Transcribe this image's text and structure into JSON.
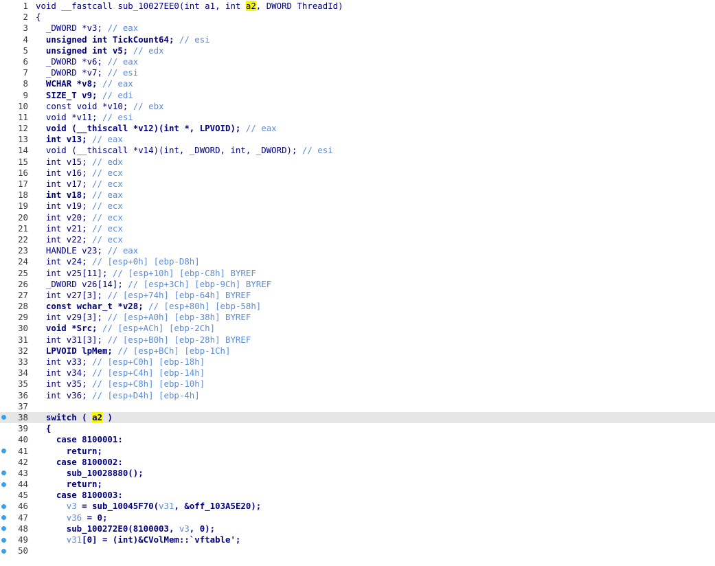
{
  "editor": {
    "lines": [
      {
        "n": "1",
        "parts": [
          [
            "p",
            "void __fastcall sub_10027EE0(int a1, int "
          ],
          [
            "h",
            "a2"
          ],
          [
            "p",
            ", DWORD ThreadId)"
          ]
        ],
        "bp": false
      },
      {
        "n": "2",
        "parts": [
          [
            "p",
            "{"
          ]
        ],
        "bp": false
      },
      {
        "n": "3",
        "parts": [
          [
            "p",
            "  _DWORD *v3; "
          ],
          [
            "c",
            "// eax"
          ]
        ],
        "bp": false
      },
      {
        "n": "4",
        "parts": [
          [
            "k",
            "  unsigned int TickCount64; "
          ],
          [
            "c",
            "// esi"
          ]
        ],
        "bp": false
      },
      {
        "n": "5",
        "parts": [
          [
            "k",
            "  unsigned int v5; "
          ],
          [
            "c",
            "// edx"
          ]
        ],
        "bp": false
      },
      {
        "n": "6",
        "parts": [
          [
            "p",
            "  _DWORD *v6; "
          ],
          [
            "c",
            "// eax"
          ]
        ],
        "bp": false
      },
      {
        "n": "7",
        "parts": [
          [
            "p",
            "  _DWORD *v7; "
          ],
          [
            "c",
            "// esi"
          ]
        ],
        "bp": false
      },
      {
        "n": "8",
        "parts": [
          [
            "k",
            "  WCHAR *v8; "
          ],
          [
            "c",
            "// eax"
          ]
        ],
        "bp": false
      },
      {
        "n": "9",
        "parts": [
          [
            "k",
            "  SIZE_T v9; "
          ],
          [
            "c",
            "// edi"
          ]
        ],
        "bp": false
      },
      {
        "n": "10",
        "parts": [
          [
            "p",
            "  const void *v10; "
          ],
          [
            "c",
            "// ebx"
          ]
        ],
        "bp": false
      },
      {
        "n": "11",
        "parts": [
          [
            "p",
            "  void *v11; "
          ],
          [
            "c",
            "// esi"
          ]
        ],
        "bp": false
      },
      {
        "n": "12",
        "parts": [
          [
            "k",
            "  void (__thiscall *v12)(int *, LPVOID); "
          ],
          [
            "c",
            "// eax"
          ]
        ],
        "bp": false
      },
      {
        "n": "13",
        "parts": [
          [
            "k",
            "  int v13; "
          ],
          [
            "c",
            "// eax"
          ]
        ],
        "bp": false
      },
      {
        "n": "14",
        "parts": [
          [
            "p",
            "  void (__thiscall *v14)(int, _DWORD, int, _DWORD); "
          ],
          [
            "c",
            "// esi"
          ]
        ],
        "bp": false
      },
      {
        "n": "15",
        "parts": [
          [
            "p",
            "  int v15; "
          ],
          [
            "c",
            "// edx"
          ]
        ],
        "bp": false
      },
      {
        "n": "16",
        "parts": [
          [
            "p",
            "  int v16; "
          ],
          [
            "c",
            "// ecx"
          ]
        ],
        "bp": false
      },
      {
        "n": "17",
        "parts": [
          [
            "p",
            "  int v17; "
          ],
          [
            "c",
            "// ecx"
          ]
        ],
        "bp": false
      },
      {
        "n": "18",
        "parts": [
          [
            "k",
            "  int v18; "
          ],
          [
            "c",
            "// eax"
          ]
        ],
        "bp": false
      },
      {
        "n": "19",
        "parts": [
          [
            "p",
            "  int v19; "
          ],
          [
            "c",
            "// ecx"
          ]
        ],
        "bp": false
      },
      {
        "n": "20",
        "parts": [
          [
            "p",
            "  int v20; "
          ],
          [
            "c",
            "// ecx"
          ]
        ],
        "bp": false
      },
      {
        "n": "21",
        "parts": [
          [
            "p",
            "  int v21; "
          ],
          [
            "c",
            "// ecx"
          ]
        ],
        "bp": false
      },
      {
        "n": "22",
        "parts": [
          [
            "p",
            "  int v22; "
          ],
          [
            "c",
            "// ecx"
          ]
        ],
        "bp": false
      },
      {
        "n": "23",
        "parts": [
          [
            "p",
            "  HANDLE v23; "
          ],
          [
            "c",
            "// eax"
          ]
        ],
        "bp": false
      },
      {
        "n": "24",
        "parts": [
          [
            "p",
            "  int v24; "
          ],
          [
            "c",
            "// [esp+0h] [ebp-D8h]"
          ]
        ],
        "bp": false
      },
      {
        "n": "25",
        "parts": [
          [
            "p",
            "  int v25[11]; "
          ],
          [
            "c",
            "// [esp+10h] [ebp-C8h] BYREF"
          ]
        ],
        "bp": false
      },
      {
        "n": "26",
        "parts": [
          [
            "p",
            "  _DWORD v26[14]; "
          ],
          [
            "c",
            "// [esp+3Ch] [ebp-9Ch] BYREF"
          ]
        ],
        "bp": false
      },
      {
        "n": "27",
        "parts": [
          [
            "p",
            "  int v27[3]; "
          ],
          [
            "c",
            "// [esp+74h] [ebp-64h] BYREF"
          ]
        ],
        "bp": false
      },
      {
        "n": "28",
        "parts": [
          [
            "k",
            "  const wchar_t *v28; "
          ],
          [
            "c",
            "// [esp+80h] [ebp-58h]"
          ]
        ],
        "bp": false
      },
      {
        "n": "29",
        "parts": [
          [
            "p",
            "  int v29[3]; "
          ],
          [
            "c",
            "// [esp+A0h] [ebp-38h] BYREF"
          ]
        ],
        "bp": false
      },
      {
        "n": "30",
        "parts": [
          [
            "k",
            "  void *Src; "
          ],
          [
            "c",
            "// [esp+ACh] [ebp-2Ch]"
          ]
        ],
        "bp": false
      },
      {
        "n": "31",
        "parts": [
          [
            "p",
            "  int v31[3]; "
          ],
          [
            "c",
            "// [esp+B0h] [ebp-28h] BYREF"
          ]
        ],
        "bp": false
      },
      {
        "n": "32",
        "parts": [
          [
            "k",
            "  LPVOID lpMem; "
          ],
          [
            "c",
            "// [esp+BCh] [ebp-1Ch]"
          ]
        ],
        "bp": false
      },
      {
        "n": "33",
        "parts": [
          [
            "p",
            "  int v33; "
          ],
          [
            "c",
            "// [esp+C0h] [ebp-18h]"
          ]
        ],
        "bp": false
      },
      {
        "n": "34",
        "parts": [
          [
            "p",
            "  int v34; "
          ],
          [
            "c",
            "// [esp+C4h] [ebp-14h]"
          ]
        ],
        "bp": false
      },
      {
        "n": "35",
        "parts": [
          [
            "p",
            "  int v35; "
          ],
          [
            "c",
            "// [esp+C8h] [ebp-10h]"
          ]
        ],
        "bp": false
      },
      {
        "n": "36",
        "parts": [
          [
            "p",
            "  int v36; "
          ],
          [
            "c",
            "// [esp+D4h] [ebp-4h]"
          ]
        ],
        "bp": false
      },
      {
        "n": "37",
        "parts": [
          [
            "p",
            ""
          ]
        ],
        "bp": false
      },
      {
        "n": "38",
        "parts": [
          [
            "k",
            "  switch ( "
          ],
          [
            "hc",
            "a"
          ],
          [
            "cur",
            ""
          ],
          [
            "hc",
            "2"
          ],
          [
            "k",
            " )"
          ]
        ],
        "bp": true,
        "current": true
      },
      {
        "n": "39",
        "parts": [
          [
            "k",
            "  {"
          ]
        ],
        "bp": false
      },
      {
        "n": "40",
        "parts": [
          [
            "k",
            "    case 8100001:"
          ]
        ],
        "bp": false
      },
      {
        "n": "41",
        "parts": [
          [
            "k",
            "      return;"
          ]
        ],
        "bp": true
      },
      {
        "n": "42",
        "parts": [
          [
            "k",
            "    case 8100002:"
          ]
        ],
        "bp": false
      },
      {
        "n": "43",
        "parts": [
          [
            "k",
            "      sub_10028880();"
          ]
        ],
        "bp": true
      },
      {
        "n": "44",
        "parts": [
          [
            "k",
            "      return;"
          ]
        ],
        "bp": true
      },
      {
        "n": "45",
        "parts": [
          [
            "k",
            "    case 8100003:"
          ]
        ],
        "bp": false
      },
      {
        "n": "46",
        "parts": [
          [
            "v",
            "      v3"
          ],
          [
            "k",
            " = sub_10045F70("
          ],
          [
            "v",
            "v31"
          ],
          [
            "k",
            ", &off_103A5E20);"
          ]
        ],
        "bp": true
      },
      {
        "n": "47",
        "parts": [
          [
            "v",
            "      v36"
          ],
          [
            "k",
            " = 0;"
          ]
        ],
        "bp": true
      },
      {
        "n": "48",
        "parts": [
          [
            "k",
            "      sub_100272E0(8100003, "
          ],
          [
            "v",
            "v3"
          ],
          [
            "k",
            ", 0);"
          ]
        ],
        "bp": true
      },
      {
        "n": "49",
        "parts": [
          [
            "v",
            "      v31"
          ],
          [
            "k",
            "[0] = (int)&CVolMem::`vftable';"
          ]
        ],
        "bp": true
      },
      {
        "n": "50",
        "parts": [
          [
            "p",
            ""
          ]
        ],
        "bp": true
      }
    ]
  }
}
